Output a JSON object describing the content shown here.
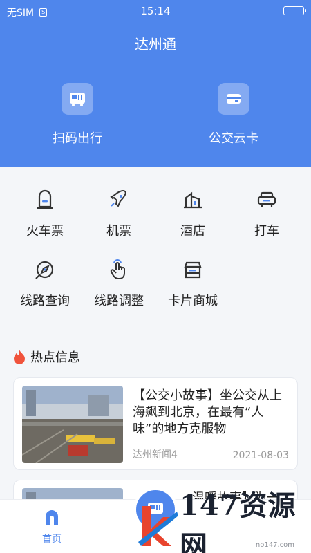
{
  "status": {
    "carrier": "无SIM",
    "time": "15:14"
  },
  "header": {
    "title": "达州通"
  },
  "quick_actions": [
    {
      "label": "扫码出行",
      "icon": "bus-scan-icon"
    },
    {
      "label": "公交云卡",
      "icon": "bus-card-icon"
    }
  ],
  "services": [
    {
      "label": "火车票",
      "icon": "train-icon"
    },
    {
      "label": "机票",
      "icon": "airplane-icon"
    },
    {
      "label": "酒店",
      "icon": "hotel-icon"
    },
    {
      "label": "打车",
      "icon": "taxi-icon"
    },
    {
      "label": "线路查询",
      "icon": "compass-icon"
    },
    {
      "label": "线路调整",
      "icon": "hand-pointer-icon"
    },
    {
      "label": "卡片商城",
      "icon": "shop-icon"
    }
  ],
  "hot": {
    "title": "热点信息"
  },
  "news": [
    {
      "title": "【公交小故事】坐公交从上海飙到北京，在最有“人味”的地方克服物",
      "source": "达州新闻4",
      "date": "2021-08-03"
    },
    {
      "title": "…温暖故事】为一",
      "source": "",
      "date": ""
    }
  ],
  "tabs": {
    "home": "首页"
  },
  "watermark": {
    "text": "147资源网",
    "url": "no147.com"
  },
  "colors": {
    "brand": "#4f86ec",
    "hot": "#f0533c"
  }
}
